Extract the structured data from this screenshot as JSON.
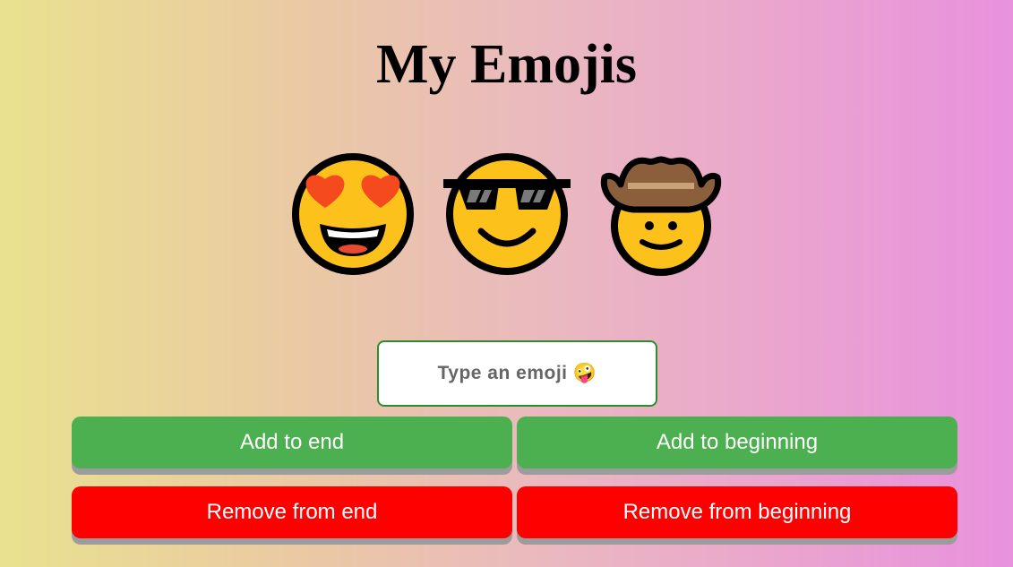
{
  "title": "My Emojis",
  "emojis": [
    {
      "icon": "heart-eyes-face-emoji"
    },
    {
      "icon": "sunglasses-face-emoji"
    },
    {
      "icon": "cowboy-face-emoji"
    }
  ],
  "input": {
    "placeholder": "Type an emoji 🤪",
    "value": ""
  },
  "buttons": {
    "add_end": "Add to end",
    "add_beginning": "Add to beginning",
    "remove_end": "Remove from end",
    "remove_beginning": "Remove from beginning"
  },
  "colors": {
    "add": "#4caf50",
    "remove": "#ff0000",
    "input_border": "#2e8b2e"
  }
}
